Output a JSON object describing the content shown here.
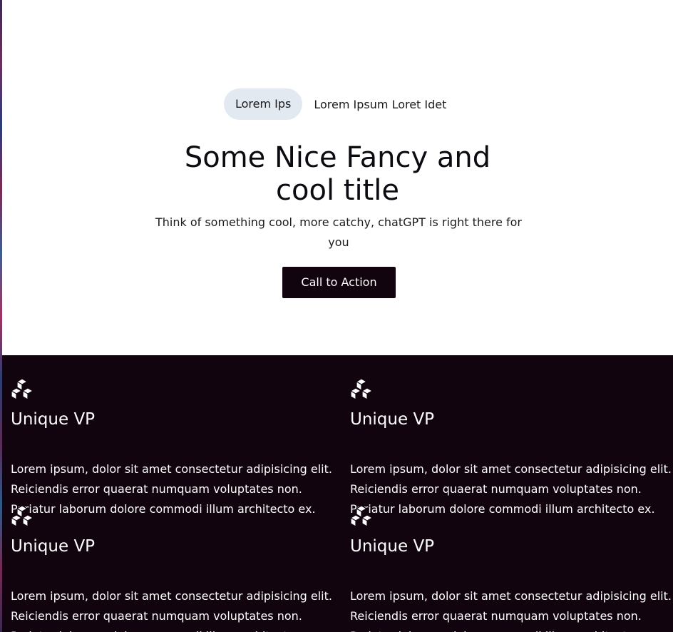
{
  "hero": {
    "pill_label": "Lorem Ips",
    "pill_text": "Lorem Ipsum Loret Idet",
    "title_line1": "Some Nice Fancy and",
    "title_line2": "cool title",
    "subtitle": "Think of something cool, more catchy, chatGPT is right there for you",
    "cta_label": "Call to Action"
  },
  "colors": {
    "dark_bg": "#12040f",
    "pill_bg": "#e3e9f1"
  },
  "features": [
    {
      "icon": "cubes-icon",
      "title": "Unique VP",
      "text": "Lorem ipsum, dolor sit amet consectetur adipisicing elit. Reiciendis error quaerat numquam voluptates non. Pariatur laborum dolore commodi illum architecto ex."
    },
    {
      "icon": "cubes-icon",
      "title": "Unique VP",
      "text": "Lorem ipsum, dolor sit amet consectetur adipisicing elit. Reiciendis error quaerat numquam voluptates non. Pariatur laborum dolore commodi illum architecto ex."
    },
    {
      "icon": "cubes-icon",
      "title": "Unique VP",
      "text": "Lorem ipsum, dolor sit amet consectetur adipisicing elit. Reiciendis error quaerat numquam voluptates non. Pariatur laborum dolore commodi illum architecto ex."
    },
    {
      "icon": "cubes-icon",
      "title": "Unique VP",
      "text": "Lorem ipsum, dolor sit amet consectetur adipisicing elit. Reiciendis error quaerat numquam voluptates non. Pariatur laborum dolore commodi illum architecto ex."
    }
  ]
}
